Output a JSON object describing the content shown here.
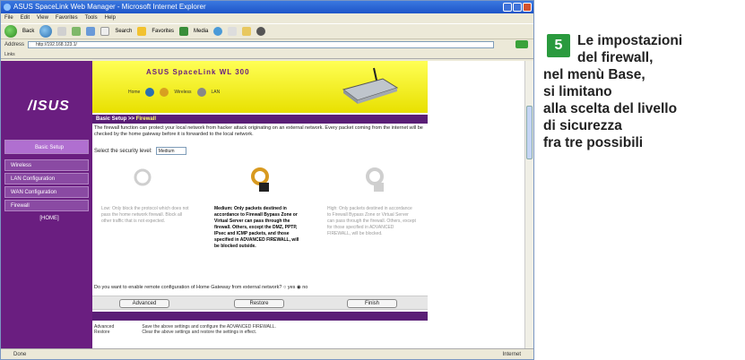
{
  "browser": {
    "title": "ASUS SpaceLink Web Manager - Microsoft Internet Explorer",
    "menu": [
      "File",
      "Edit",
      "View",
      "Favorites",
      "Tools",
      "Help"
    ],
    "toolbar": {
      "back": "Back",
      "search": "Search",
      "favorites": "Favorites",
      "media": "Media"
    },
    "address_label": "Address",
    "address_value": "http://192.168.123.1/",
    "links_label": "Links",
    "status_left": "Done",
    "status_zone": "Internet"
  },
  "router": {
    "logo": "/ISUS",
    "product": "ASUS SpaceLink WL 300",
    "banner_icons": [
      "Home",
      "Wireless",
      "LAN"
    ],
    "nav": {
      "basic_setup": "Basic Setup",
      "items": [
        "Wireless",
        "LAN Configuration",
        "WAN Configuration",
        "Firewall"
      ],
      "home": "[HOME]"
    },
    "crumb_prefix": "Basic Setup >>",
    "crumb_current": "Firewall",
    "description": "The firewall function can protect your local network from hacker attack originating on an external network. Every packet coming from the internet will be checked by the home gateway before it is forwarded to the local network.",
    "level_label": "Select the security level:",
    "level_value": "Medium",
    "levels": [
      {
        "text": "Low: Only block the protocol which does not pass the home network firewall. Block all other traffic that is not expected.",
        "selected": false
      },
      {
        "text": "Medium: Only packets destined in accordance to Firewall Bypass Zone or Virtual Server can pass through the firewall. Others, except the DMZ, PPTP, IPsec and ICMP packets, and those specified in ADVANCED FIREWALL, will be blocked outside.",
        "selected": true
      },
      {
        "text": "High: Only packets destined in accordance to Firewall Bypass Zone or Virtual Server can pass through the firewall. Others, except for those specified in ADVANCED FIREWALL, will be blocked.",
        "selected": false
      }
    ],
    "remote_question": "Do you want to enable remote configuration of Home Gateway from external network?",
    "remote_yes": "yes",
    "remote_no": "no",
    "buttons": {
      "advanced": "Advanced",
      "restore": "Restore",
      "finish": "Finish"
    },
    "hint_key1": "Advanced",
    "hint_val1": "Save the above settings and configure the ADVANCED FIREWALL.",
    "hint_key2": "Restore",
    "hint_val2": "Clear the above settings and restore the settings in effect."
  },
  "caption": {
    "number": "5",
    "lines": [
      "Le impostazioni",
      "del firewall,",
      "nel menù Base,",
      "si limitano",
      "alla scelta del livello",
      "di sicurezza",
      "fra tre possibili"
    ]
  },
  "colors": {
    "number_bg": "#2a9a3e",
    "router_purple": "#6a1e80",
    "banner_yellow": "#f0ea1e"
  }
}
